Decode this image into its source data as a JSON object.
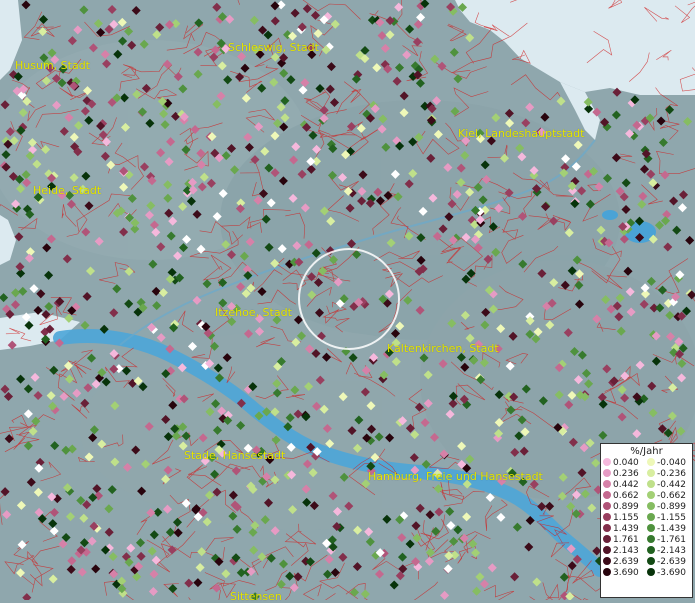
{
  "map": {
    "cities": [
      {
        "name": "Schleswig, Stadt"
      },
      {
        "name": "Husum, Stadt"
      },
      {
        "name": "Kiel, Landeshauptstadt"
      },
      {
        "name": "Heide, Stadt"
      },
      {
        "name": "Itzehoe, Stadt"
      },
      {
        "name": "Kaltenkirchen, Stadt"
      },
      {
        "name": "Stade, Hansestadt"
      },
      {
        "name": "Hamburg, Freie und Hansestadt"
      },
      {
        "name": "Sittensen"
      }
    ]
  },
  "legend": {
    "unit": "%/Jahr",
    "positive": [
      {
        "value": "0.040",
        "color": "#f5b8dc"
      },
      {
        "value": "0.236",
        "color": "#e69bc4"
      },
      {
        "value": "0.442",
        "color": "#d681a8"
      },
      {
        "value": "0.662",
        "color": "#c4698f"
      },
      {
        "value": "0.899",
        "color": "#b05478"
      },
      {
        "value": "1.155",
        "color": "#994060"
      },
      {
        "value": "1.439",
        "color": "#822f4b"
      },
      {
        "value": "1.761",
        "color": "#6a2038"
      },
      {
        "value": "2.143",
        "color": "#521427"
      },
      {
        "value": "2.639",
        "color": "#3c0b19"
      },
      {
        "value": "3.690",
        "color": "#28040d"
      }
    ],
    "negative": [
      {
        "value": "-0.040",
        "color": "#eef8b8"
      },
      {
        "value": "-0.236",
        "color": "#d8eea0"
      },
      {
        "value": "-0.442",
        "color": "#bfe08a"
      },
      {
        "value": "-0.662",
        "color": "#a3d075"
      },
      {
        "value": "-0.899",
        "color": "#86bd62"
      },
      {
        "value": "-1.155",
        "color": "#6aa84f"
      },
      {
        "value": "-1.439",
        "color": "#4f923e"
      },
      {
        "value": "-1.761",
        "color": "#377a2e"
      },
      {
        "value": "-2.143",
        "color": "#226220"
      },
      {
        "value": "-2.639",
        "color": "#134a14"
      },
      {
        "value": "-3.690",
        "color": "#07330a"
      }
    ]
  }
}
